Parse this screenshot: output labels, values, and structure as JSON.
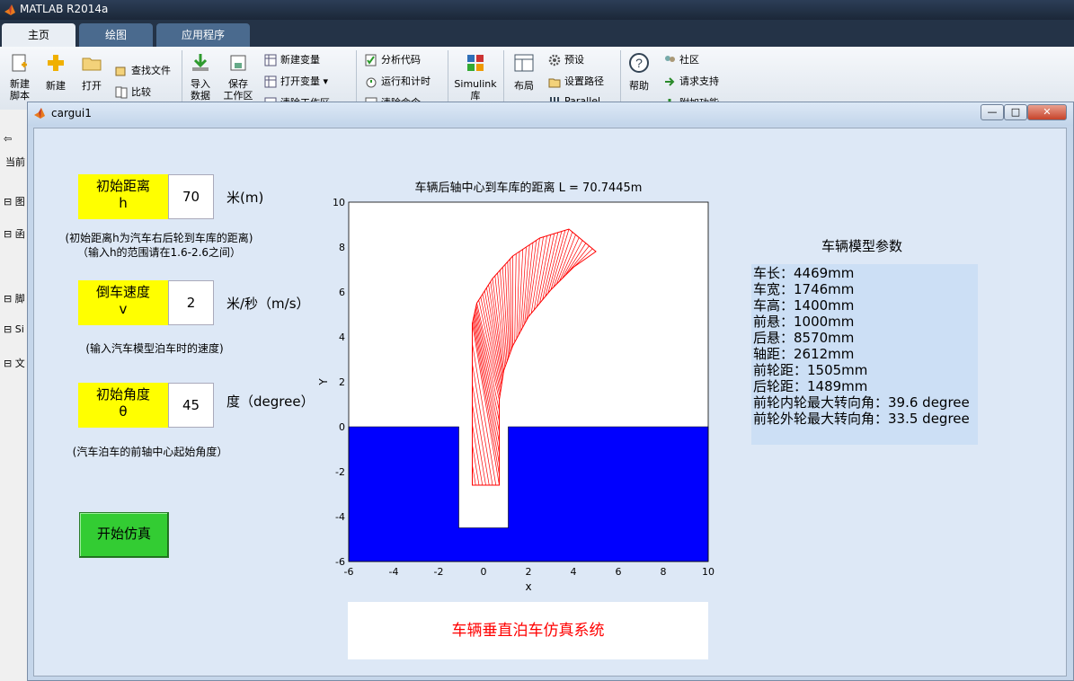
{
  "app": {
    "title": "MATLAB R2014a"
  },
  "tabs": [
    {
      "label": "主页"
    },
    {
      "label": "绘图"
    },
    {
      "label": "应用程序"
    }
  ],
  "ribbon": {
    "new_script": "新建\n脚本",
    "new": "新建",
    "open": "打开",
    "find_files": "查找文件",
    "compare": "比较",
    "import": "导入\n数据",
    "save": "保存\n工作区",
    "new_variable": "新建变量",
    "open_variable": "打开变量",
    "clear_workspace": "清除工作区",
    "analyze_code": "分析代码",
    "run_and_time": "运行和计时",
    "clear_commands": "清除命令",
    "simulink": "Simulink\n库",
    "layout": "布局",
    "preferences": "预设",
    "set_path": "设置路径",
    "parallel": "Parallel",
    "help": "帮助",
    "community": "社区",
    "request_support": "请求支持",
    "addons": "附加功能"
  },
  "left_stub": {
    "current": "当前",
    "items": [
      "图",
      "函",
      "脚",
      "Si",
      "文"
    ]
  },
  "figure": {
    "title": "cargui1",
    "minimize": "—",
    "maximize": "□",
    "close": "✕"
  },
  "controls": {
    "distance": {
      "label": "初始距离\nh",
      "value": "70",
      "unit": "米(m)",
      "note": "(初始距离h为汽车右后轮到车库的距离)\n（输入h的范围请在1.6-2.6之间）"
    },
    "speed": {
      "label": "倒车速度\nv",
      "value": "2",
      "unit": "米/秒（m/s）",
      "note": "(输入汽车模型泊车时的速度)"
    },
    "angle": {
      "label": "初始角度\nθ",
      "value": "45",
      "unit": "度（degree）",
      "note": "(汽车泊车的前轴中心起始角度）"
    },
    "start_button": "开始仿真"
  },
  "params": {
    "title": "车辆模型参数",
    "lines": [
      "车长：4469mm",
      "车宽：1746mm",
      "车高：1400mm",
      "前悬：1000mm",
      "后悬：8570mm",
      "轴距：2612mm",
      "前轮距：1505mm",
      "后轮距：1489mm",
      "前轮内轮最大转向角：39.6 degree",
      "前轮外轮最大转向角：33.5 degree"
    ]
  },
  "footer": {
    "text": "车辆垂直泊车仿真系统"
  },
  "colors": {
    "ground": "#0000ff",
    "trajectory": "#ff0000",
    "label_bg": "#ffff00",
    "button": "#33cc33"
  },
  "chart_data": {
    "type": "line",
    "title": "车辆后轴中心到车库的距离 L = 70.7445m",
    "xlabel": "x",
    "ylabel": "Y",
    "xlim": [
      -6,
      10
    ],
    "ylim": [
      -6,
      10
    ],
    "xticks": [
      -6,
      -4,
      -2,
      0,
      2,
      4,
      6,
      8,
      10
    ],
    "yticks": [
      -6,
      -4,
      -2,
      0,
      2,
      4,
      6,
      8,
      10
    ],
    "grid": false,
    "filled_regions": [
      {
        "name": "",
        "polygon": [
          [
            -6,
            0
          ],
          [
            -1.1,
            0
          ],
          [
            -1.1,
            -4.5
          ],
          [
            1.1,
            -4.5
          ],
          [
            1.1,
            0
          ],
          [
            10,
            0
          ],
          [
            10,
            -6
          ],
          [
            -6,
            -6
          ]
        ]
      }
    ],
    "series": [
      {
        "name": "",
        "points": [
          [
            -0.5,
            -2.6
          ],
          [
            0.7,
            -2.6
          ],
          [
            0.7,
            1.2
          ],
          [
            0.9,
            2.5
          ],
          [
            1.3,
            3.6
          ],
          [
            2.0,
            4.9
          ],
          [
            3.0,
            6.1
          ],
          [
            4.0,
            7.1
          ],
          [
            5.0,
            7.8
          ],
          [
            3.8,
            8.8
          ],
          [
            2.5,
            8.4
          ],
          [
            1.3,
            7.6
          ],
          [
            0.4,
            6.6
          ],
          [
            -0.3,
            5.5
          ],
          [
            -0.5,
            4.6
          ],
          [
            -0.5,
            -2.6
          ]
        ]
      }
    ]
  }
}
